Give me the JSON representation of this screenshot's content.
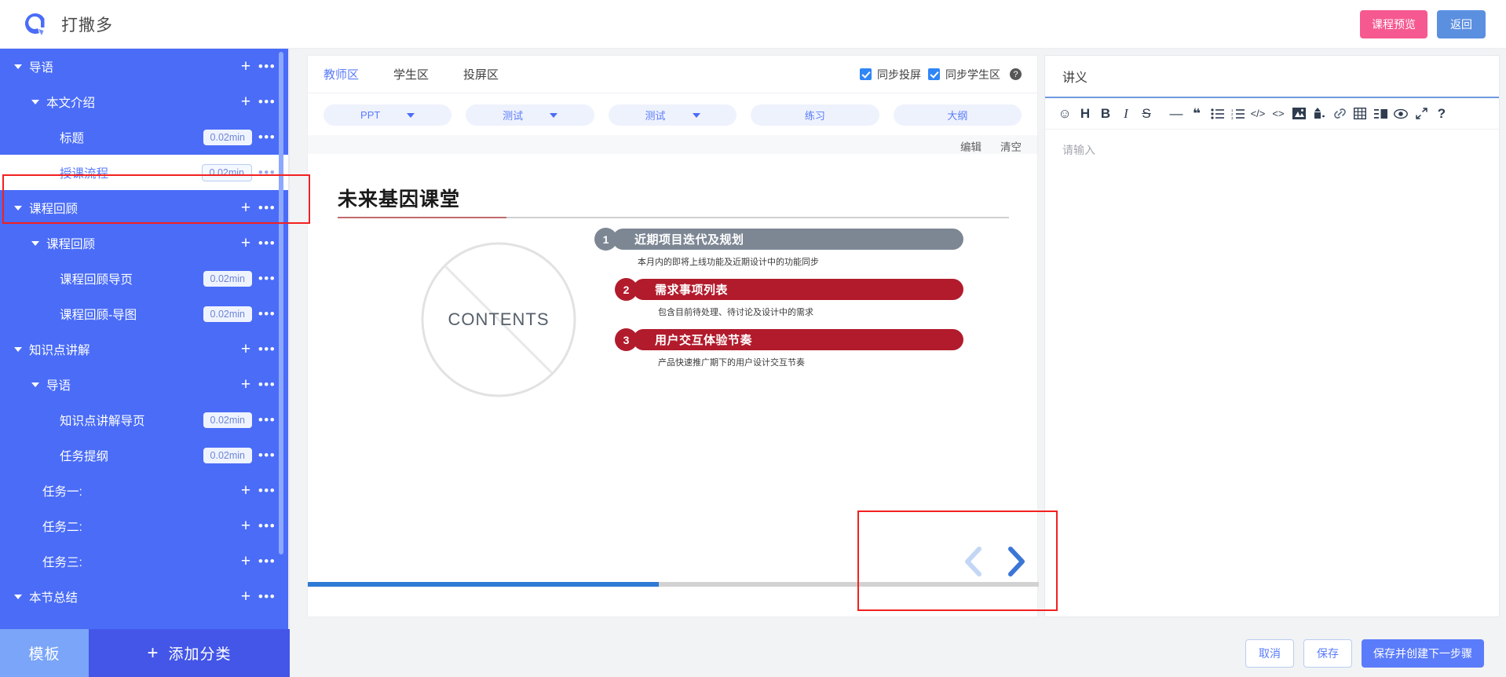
{
  "topbar": {
    "app_title": "打撒多",
    "logo_icon": "brand-logo-icon",
    "preview_label": "课程预览",
    "back_label": "返回",
    "preview_color": "#f6598f",
    "back_color": "#5b8fe0"
  },
  "sidebar": {
    "accent": "#4a6cf7",
    "nodes": [
      {
        "label": "导语",
        "indent": 0,
        "caret": true,
        "action": "plus",
        "selected": false
      },
      {
        "label": "本文介绍",
        "indent": 1,
        "caret": true,
        "action": "plus",
        "selected": false
      },
      {
        "label": "标题",
        "indent": 2,
        "caret": false,
        "action": "dur",
        "duration": "0.02min",
        "selected": false
      },
      {
        "label": "授课流程",
        "indent": 2,
        "caret": false,
        "action": "dur",
        "duration": "0.02min",
        "selected": true
      },
      {
        "label": "课程回顾",
        "indent": 0,
        "caret": true,
        "action": "plus",
        "selected": false
      },
      {
        "label": "课程回顾",
        "indent": 1,
        "caret": true,
        "action": "plus",
        "selected": false
      },
      {
        "label": "课程回顾导页",
        "indent": 2,
        "caret": false,
        "action": "dur",
        "duration": "0.02min",
        "selected": false
      },
      {
        "label": "课程回顾-导图",
        "indent": 2,
        "caret": false,
        "action": "dur",
        "duration": "0.02min",
        "selected": false
      },
      {
        "label": "知识点讲解",
        "indent": 0,
        "caret": true,
        "action": "plus",
        "selected": false
      },
      {
        "label": "导语",
        "indent": 1,
        "caret": true,
        "action": "plus",
        "selected": false
      },
      {
        "label": "知识点讲解导页",
        "indent": 2,
        "caret": false,
        "action": "dur",
        "duration": "0.02min",
        "selected": false
      },
      {
        "label": "任务提纲",
        "indent": 2,
        "caret": false,
        "action": "dur",
        "duration": "0.02min",
        "selected": false
      },
      {
        "label": "任务一:",
        "indent": 1,
        "caret": false,
        "action": "plus",
        "selected": false
      },
      {
        "label": "任务二:",
        "indent": 1,
        "caret": false,
        "action": "plus",
        "selected": false
      },
      {
        "label": "任务三:",
        "indent": 1,
        "caret": false,
        "action": "plus",
        "selected": false
      },
      {
        "label": "本节总结",
        "indent": 0,
        "caret": true,
        "action": "plus",
        "selected": false
      }
    ],
    "footer": {
      "template_label": "模板",
      "add_category_label": "添加分类",
      "add_icon": "plus-icon"
    }
  },
  "center": {
    "tabs": [
      {
        "label": "教师区",
        "active": true
      },
      {
        "label": "学生区",
        "active": false
      },
      {
        "label": "投屏区",
        "active": false
      }
    ],
    "sync": [
      {
        "label": "同步投屏",
        "checked": true
      },
      {
        "label": "同步学生区",
        "checked": true
      }
    ],
    "help_icon": "question-mark-icon",
    "pills": [
      {
        "label": "PPT",
        "dropdown": true
      },
      {
        "label": "测试",
        "dropdown": true
      },
      {
        "label": "测试",
        "dropdown": true
      },
      {
        "label": "练习",
        "dropdown": false
      },
      {
        "label": "大纲",
        "dropdown": false
      }
    ],
    "edit_label": "编辑",
    "clear_label": "清空",
    "slide": {
      "title": "未来基因课堂",
      "circle_label": "CONTENTS",
      "items": [
        {
          "num": "1",
          "title": "近期项目迭代及规划",
          "desc": "本月内的即将上线功能及近期设计中的功能同步",
          "color": "#7d8794"
        },
        {
          "num": "2",
          "title": "需求事项列表",
          "desc": "包含目前待处理、待讨论及设计中的需求",
          "color": "#b21b2c"
        },
        {
          "num": "3",
          "title": "用户交互体验节奏",
          "desc": "产品快速推广期下的用户设计交互节奏",
          "color": "#b21b2c"
        }
      ],
      "prev_icon": "chevron-left-icon",
      "next_icon": "chevron-right-icon",
      "scroll_percent": 48
    }
  },
  "right_panel": {
    "title": "讲义",
    "placeholder": "请输入",
    "toolbar_icons": [
      "emoji-icon",
      "heading-icon",
      "bold-icon",
      "italic-icon",
      "strikethrough-icon",
      "horizontal-rule-icon",
      "quote-icon",
      "unordered-list-icon",
      "ordered-list-icon",
      "inline-code-icon",
      "code-block-icon",
      "image-icon",
      "upload-icon",
      "link-icon",
      "table-icon",
      "layout-icon",
      "preview-eye-icon",
      "fullscreen-icon",
      "help-icon"
    ]
  },
  "bottombar": {
    "cancel_label": "取消",
    "save_label": "保存",
    "save_next_label": "保存并创建下一步骤"
  }
}
